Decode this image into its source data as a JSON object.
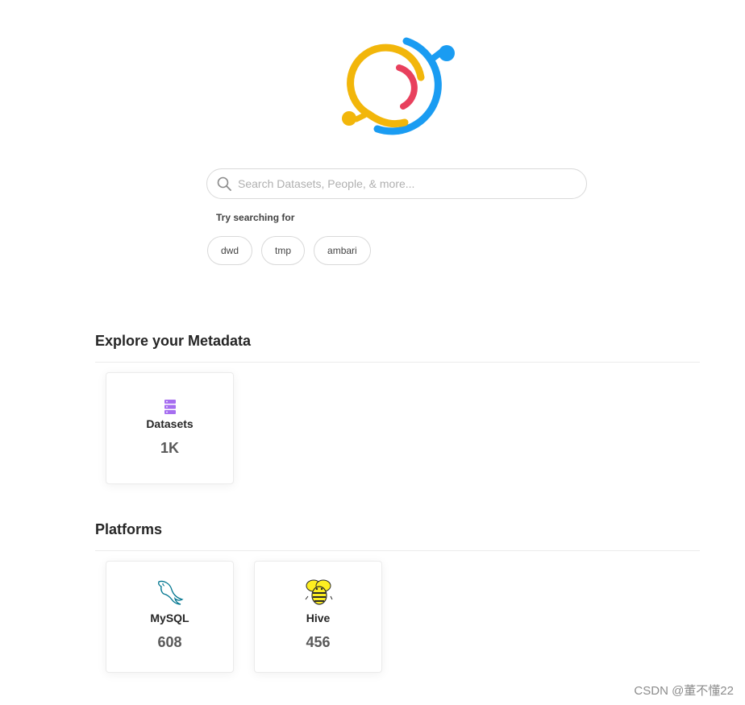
{
  "search": {
    "placeholder": "Search Datasets, People, & more..."
  },
  "suggestions": {
    "label": "Try searching for",
    "items": [
      "dwd",
      "tmp",
      "ambari"
    ]
  },
  "explore": {
    "title": "Explore your Metadata",
    "cards": [
      {
        "label": "Datasets",
        "count": "1K",
        "icon": "database-icon",
        "color": "#a66ef0"
      }
    ]
  },
  "platforms": {
    "title": "Platforms",
    "cards": [
      {
        "label": "MySQL",
        "count": "608",
        "icon": "mysql-dolphin-icon"
      },
      {
        "label": "Hive",
        "count": "456",
        "icon": "hive-bee-icon"
      }
    ]
  },
  "watermark": "CSDN @董不懂22",
  "colors": {
    "logo_blue": "#1a9cf2",
    "logo_yellow": "#f2b60a",
    "logo_red": "#e8405d"
  }
}
